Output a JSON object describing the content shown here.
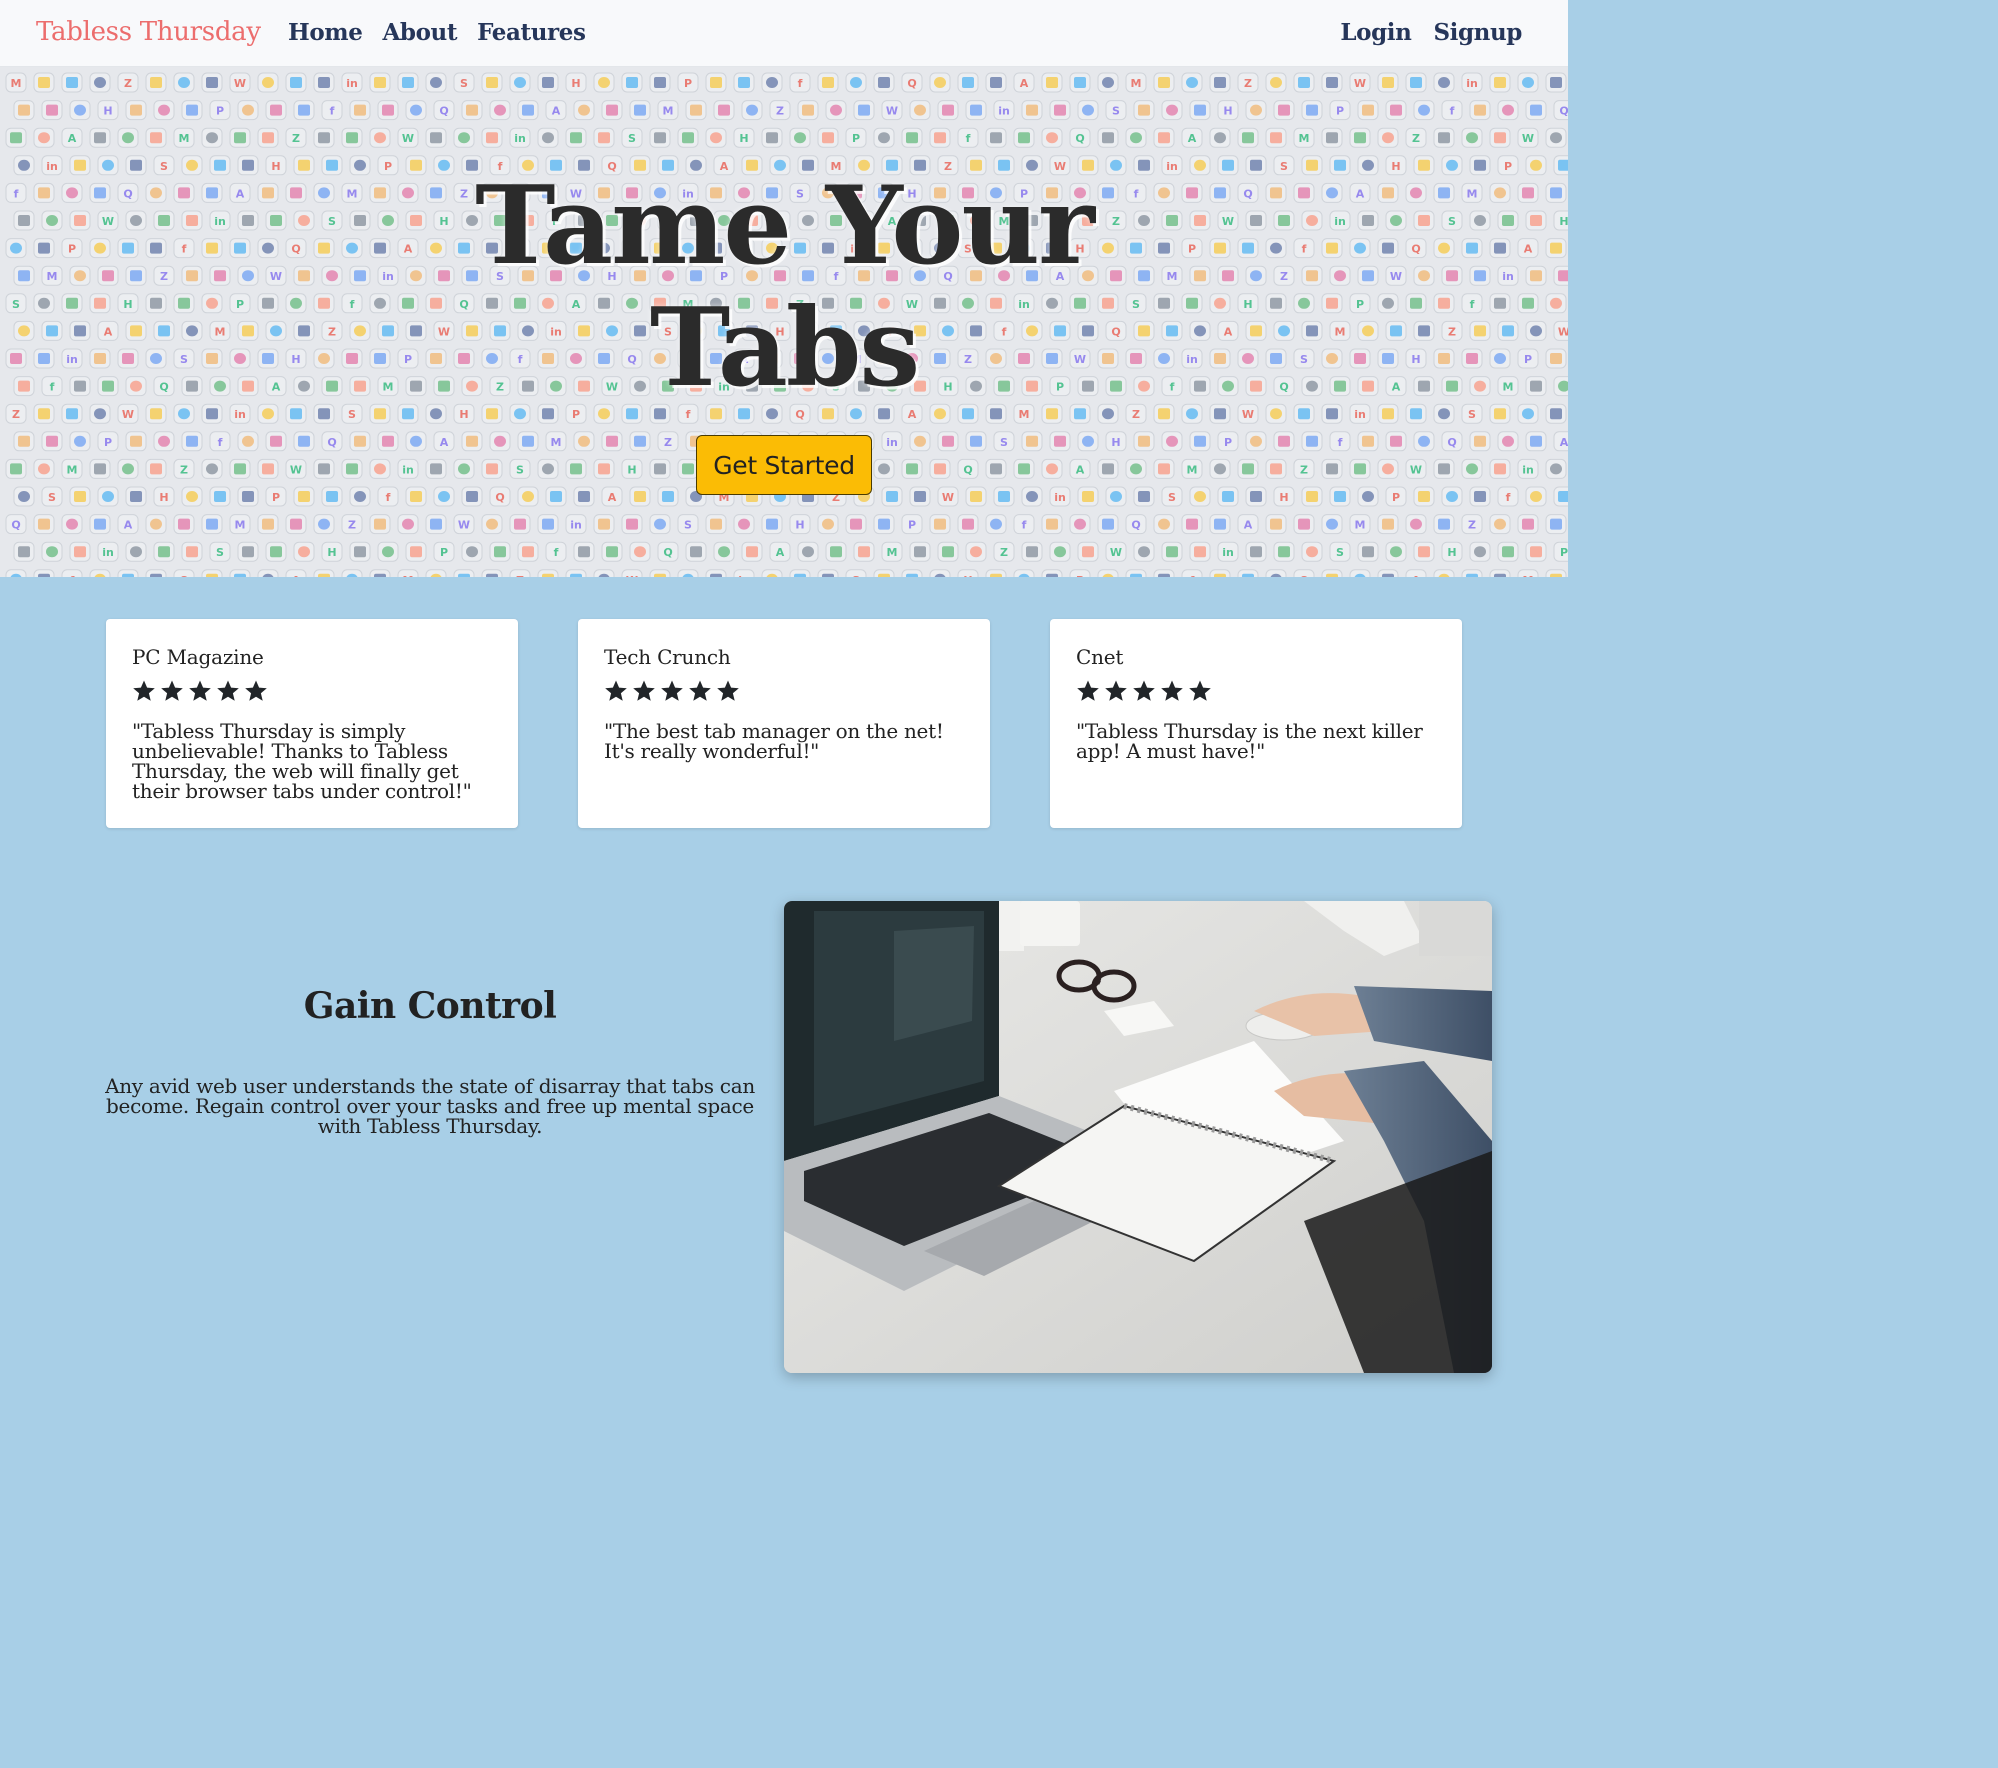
{
  "nav": {
    "brand": "Tabless Thursday",
    "left_links": [
      "Home",
      "About",
      "Features"
    ],
    "right_links": [
      "Login",
      "Signup"
    ]
  },
  "hero": {
    "title_line1": "Tame Your",
    "title_line2": "Tabs",
    "cta_label": "Get Started",
    "background": "app-icon-pattern"
  },
  "reviews": [
    {
      "source": "PC Magazine",
      "rating": 5,
      "quote": "\"Tabless Thursday is simply unbelievable! Thanks to Tabless Thursday, the web will finally get their browser tabs under control!\""
    },
    {
      "source": "Tech Crunch",
      "rating": 5,
      "quote": "\"The best tab manager on the net! It's really wonderful!\""
    },
    {
      "source": "Cnet",
      "rating": 5,
      "quote": "\"Tabless Thursday is the next killer app! A must have!\""
    }
  ],
  "gain_control": {
    "title": "Gain Control",
    "body": "Any avid web user understands the state of disarray that tabs can become. Regain control over your tasks and free up mental space with Tabless Thursday.",
    "image": "laptop-desk-photo"
  },
  "colors": {
    "brand": "#ec6d6d",
    "nav_link": "#26365a",
    "page_bg": "#a8cfe7",
    "cta": "#fbbc05"
  }
}
